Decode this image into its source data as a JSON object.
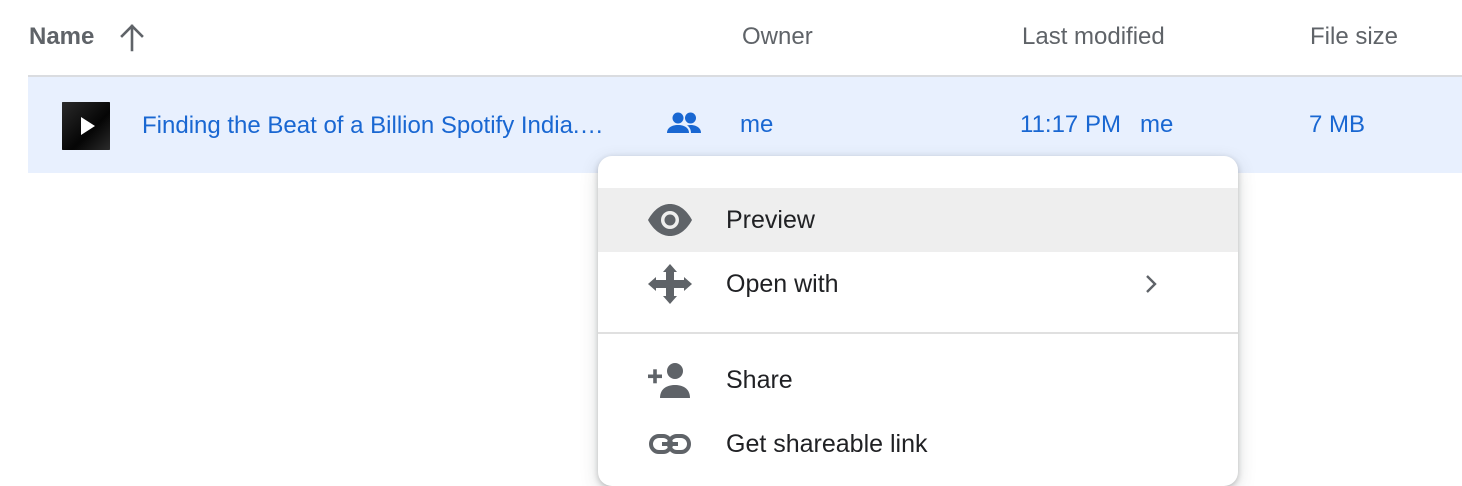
{
  "header": {
    "name_label": "Name",
    "owner_label": "Owner",
    "modified_label": "Last modified",
    "size_label": "File size",
    "sort_icon": "arrow-up-icon"
  },
  "file_row": {
    "thumbnail_icon": "video-play-icon",
    "name": "Finding the Beat of a Billion Spotify India.…",
    "shared_icon": "people-icon",
    "owner": "me",
    "modified_time": "11:17 PM",
    "modified_by": "me",
    "size": "7 MB"
  },
  "context_menu": {
    "items": [
      {
        "label": "Preview",
        "icon": "eye-icon"
      },
      {
        "label": "Open with",
        "icon": "move-arrows-icon",
        "submenu_icon": "chevron-right-icon"
      },
      {
        "label": "Share",
        "icon": "person-add-icon"
      },
      {
        "label": "Get shareable link",
        "icon": "link-icon"
      }
    ]
  },
  "colors": {
    "selected_row": "#e8f0fe",
    "accent_text": "#1967d2",
    "hover_item": "#eeeeee",
    "icon_gray": "#5f6368"
  }
}
